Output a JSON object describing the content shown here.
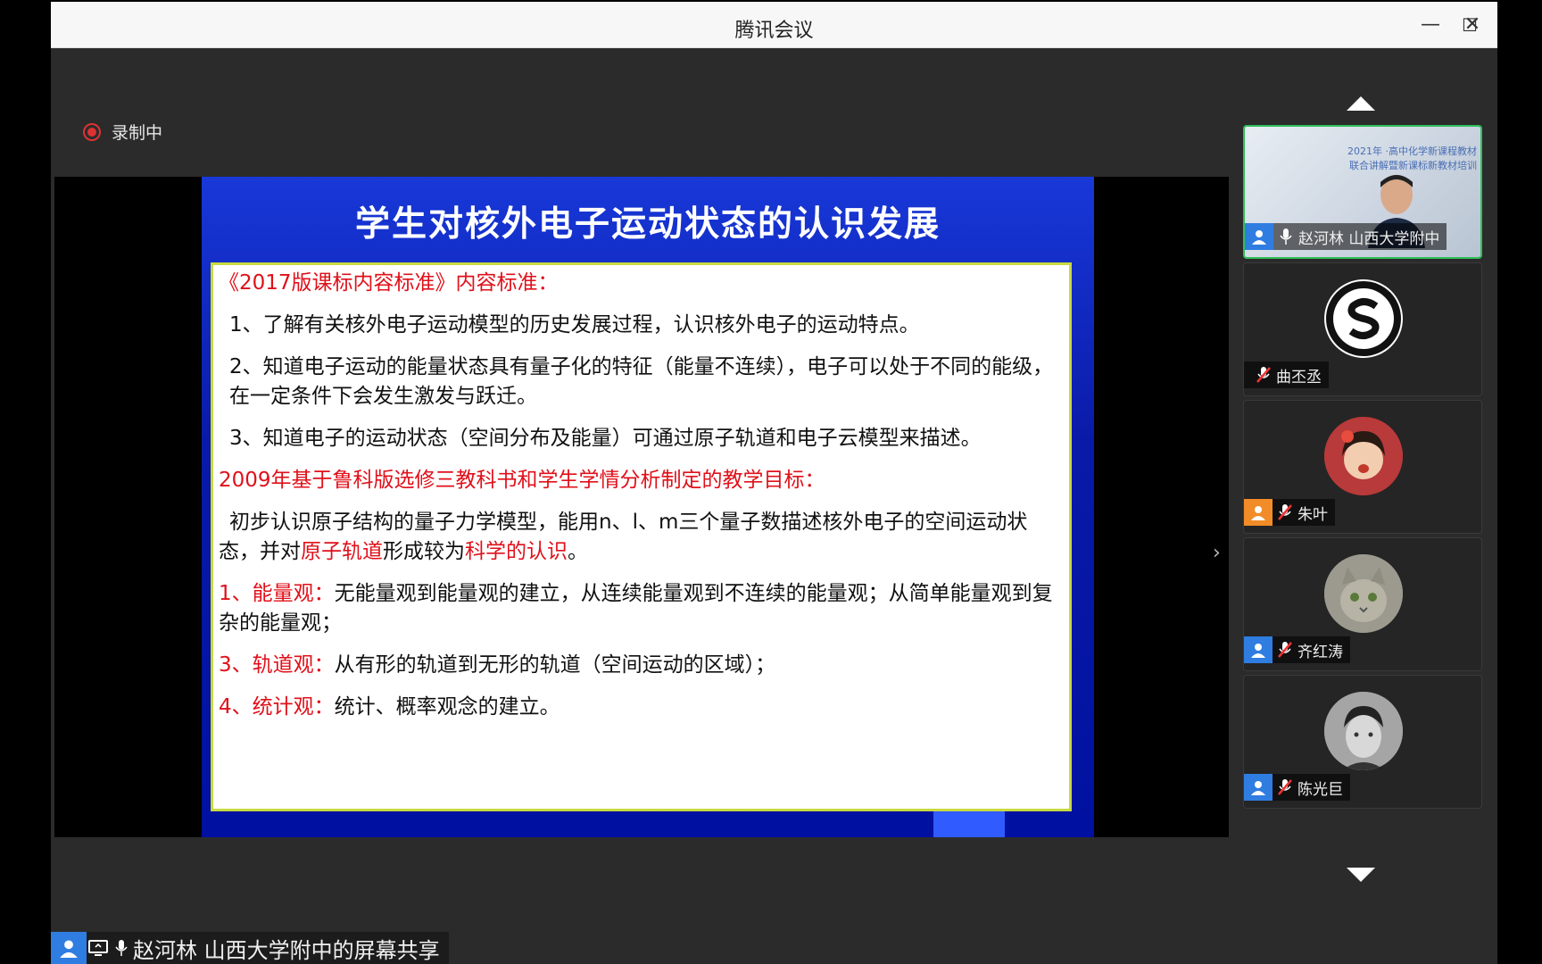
{
  "window": {
    "title": "腾讯会议",
    "controls": {
      "minimize": "—",
      "maximize": "☐",
      "close": "✕"
    }
  },
  "recording": {
    "label": "录制中",
    "color": "#dd3333"
  },
  "slide": {
    "title": "学生对核外电子运动状态的认识发展",
    "standard_heading": "《2017版课标内容标准》内容标准：",
    "item1": "1、了解有关核外电子运动模型的历史发展过程，认识核外电子的运动特点。",
    "item2": "2、知道电子运动的能量状态具有量子化的特征（能量不连续），电子可以处于不同的能级，在一定条件下会发生激发与跃迁。",
    "item3": "3、知道电子的运动状态（空间分布及能量）可通过原子轨道和电子云模型来描述。",
    "goal_heading": "2009年基于鲁科版选修三教科书和学生学情分析制定的教学目标：",
    "goal_p1": "初步认识原子结构的量子力学模型，能用n、l、m三个量子数描述核外电子的空间运动状态，并对",
    "goal_p1_red1": "原子轨道",
    "goal_p1_mid": "形成较为",
    "goal_p1_red2": "科学的认识",
    "goal_p1_end": "。",
    "view1_label": "1、能量观：",
    "view1_text": "无能量观到能量观的建立，从连续能量观到不连续的能量观；从简单能量观到复杂的能量观；",
    "view3_label": "3、轨道观：",
    "view3_text": "从有形的轨道到无形的轨道（空间运动的区域）；",
    "view4_label": "4、统计观：",
    "view4_text": "统计、概率观念的建立。"
  },
  "participants": [
    {
      "name": "赵河林 山西大学附中",
      "video_text": "2021年 ·高中化学新课程教材联合讲解暨新课标新教材培训",
      "badge": "blue",
      "mic": "on",
      "active": true
    },
    {
      "name": "曲丕丞",
      "badge": "none",
      "mic": "muted",
      "avatar_icon": "school-logo"
    },
    {
      "name": "朱叶",
      "badge": "orange",
      "mic": "muted",
      "avatar_icon": "girl-photo"
    },
    {
      "name": "齐红涛",
      "badge": "blue",
      "mic": "muted",
      "avatar_icon": "cat-photo"
    },
    {
      "name": "陈光巨",
      "badge": "blue",
      "mic": "muted",
      "avatar_icon": "man-photo"
    }
  ],
  "bottom": {
    "label": "赵河林 山西大学附中的屏幕共享"
  },
  "colors": {
    "accent_blue": "#2f7de1",
    "accent_orange": "#f28c28",
    "active_border": "#2fbf5a",
    "slide_red": "#e0101a"
  }
}
